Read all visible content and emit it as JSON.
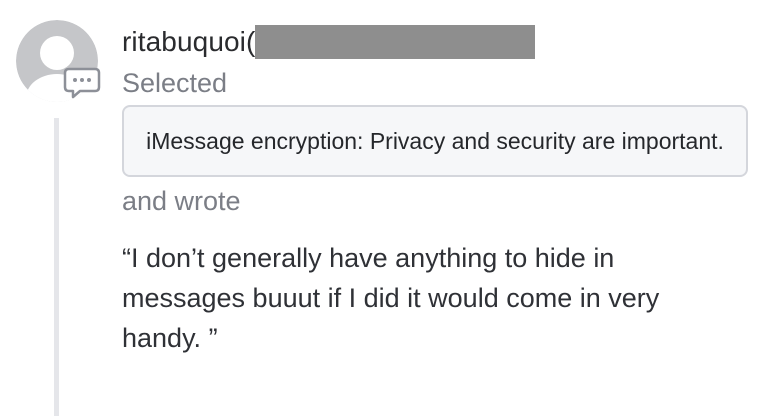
{
  "comment": {
    "username": "ritabuquoi(",
    "selected_label": "Selected",
    "quoted_text": "iMessage encryption: Privacy and security are important.",
    "wrote_label": "and wrote",
    "message": "“I don’t generally have anything to hide in messages buuut if I did it would come in very handy. ”"
  },
  "icons": {
    "avatar": "default-user-avatar",
    "badge": "comment-bubble-icon"
  },
  "colors": {
    "avatar_gray": "#c5c6c9",
    "thread_line": "#e5e6ea",
    "muted_text": "#7b7e86",
    "quote_background": "#f6f7f9",
    "redaction": "#8e8e8e"
  }
}
